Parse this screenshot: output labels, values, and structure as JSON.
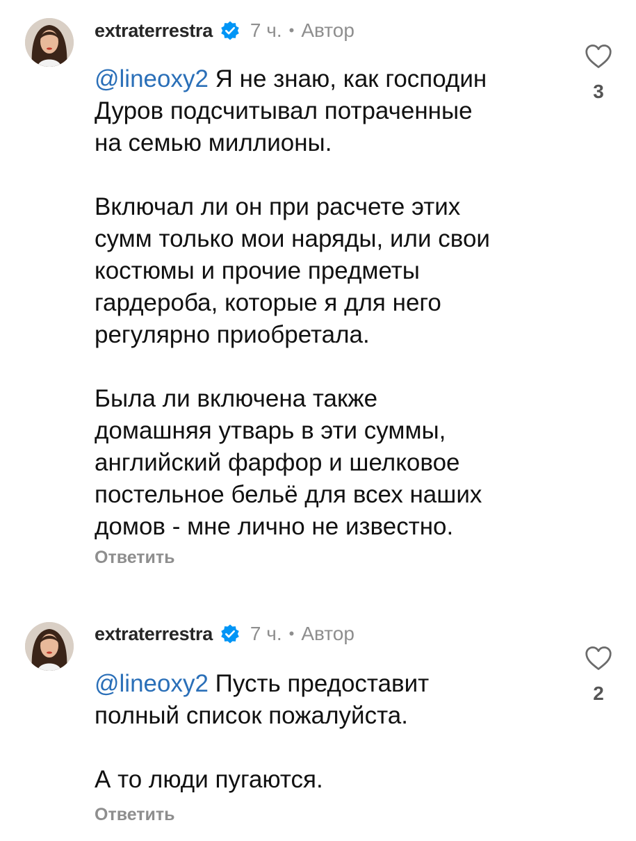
{
  "comments": [
    {
      "username": "extraterrestra",
      "time": "7 ч.",
      "separator": "•",
      "author_label": "Автор",
      "mention": "@lineoxy2",
      "text": " Я не знаю, как господин\nДуров подсчитывал потраченные\nна семью миллионы.\n\nВключал ли он при расчете этих\nсумм только мои наряды, или свои\nкостюмы и прочие предметы\nгардероба, которые я для него\nрегулярно приобретала.\n\nБыла ли включена также\nдомашняя утварь в эти суммы,\nанглийский фарфор и шелковое\nпостельное бельё для всех наших\nдомов - мне лично не известно.",
      "reply_label": "Ответить",
      "likes": "3",
      "icons": {
        "avatar": "avatar",
        "verified": "verified-badge-icon",
        "like": "heart-icon"
      }
    },
    {
      "username": "extraterrestra",
      "time": "7 ч.",
      "separator": "•",
      "author_label": "Автор",
      "mention": "@lineoxy2",
      "text": " Пусть предоставит\nполный список пожалуйста.\n\nА то люди пугаются.",
      "reply_label": "Ответить",
      "likes": "2",
      "icons": {
        "avatar": "avatar",
        "verified": "verified-badge-icon",
        "like": "heart-icon"
      }
    }
  ],
  "colors": {
    "mention": "#2a6fb8",
    "verified": "#0095f6",
    "meta": "#8e8e8e",
    "text": "#111111"
  }
}
